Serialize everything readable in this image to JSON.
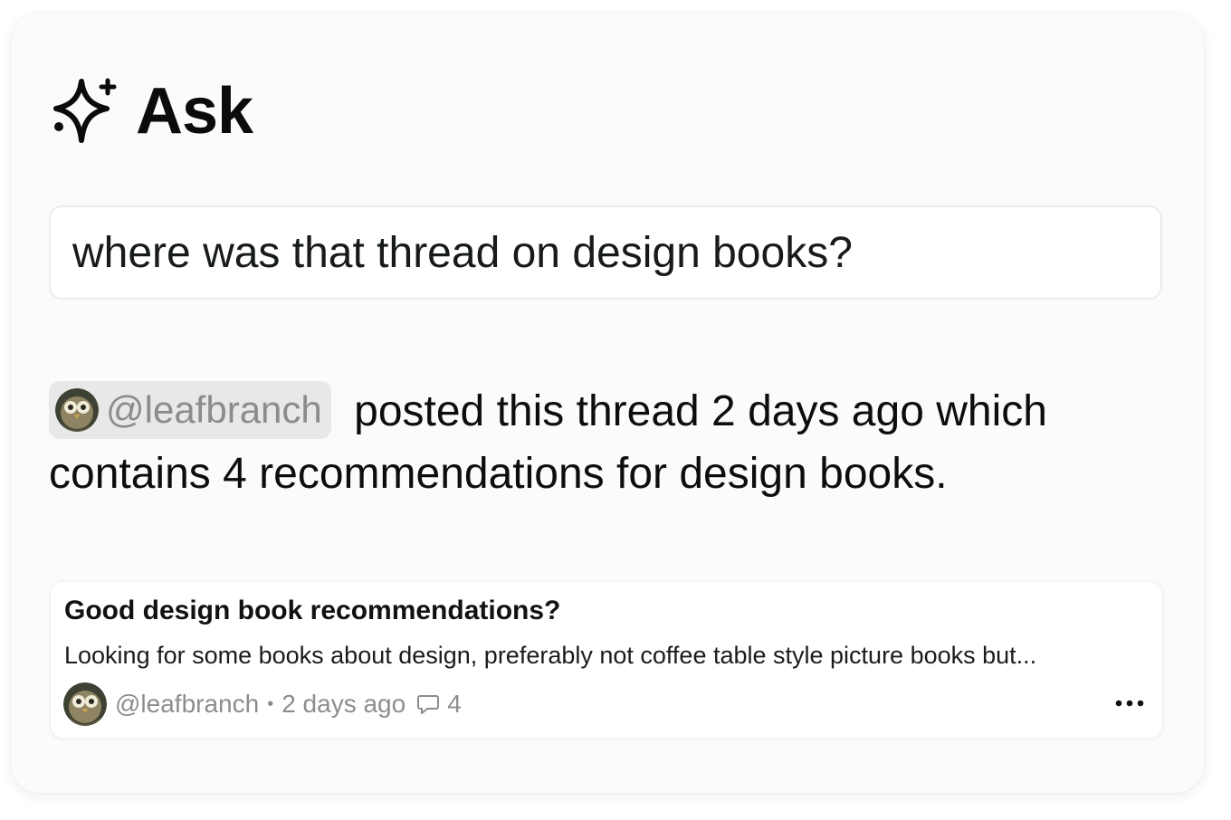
{
  "header": {
    "title": "Ask",
    "icon": "sparkle-icon"
  },
  "query": {
    "text": "where was that thread on design books?"
  },
  "answer": {
    "mention": "@leafbranch",
    "text": " posted this thread 2 days ago which contains 4 recommendations for design books."
  },
  "thread": {
    "title": "Good design book recommendations?",
    "snippet": "Looking for some books about design, preferably not coffee table style picture books but...",
    "author": "@leafbranch",
    "separator": "•",
    "time": "2 days ago",
    "comment_count": "4",
    "more_icon": "more-horizontal-icon",
    "comment_icon": "comment-icon"
  },
  "colors": {
    "card_bg": "#fcfbfa",
    "chip_bg": "#e8e8e8",
    "muted_text": "#8c8c8c",
    "text": "#0d0d0d"
  }
}
